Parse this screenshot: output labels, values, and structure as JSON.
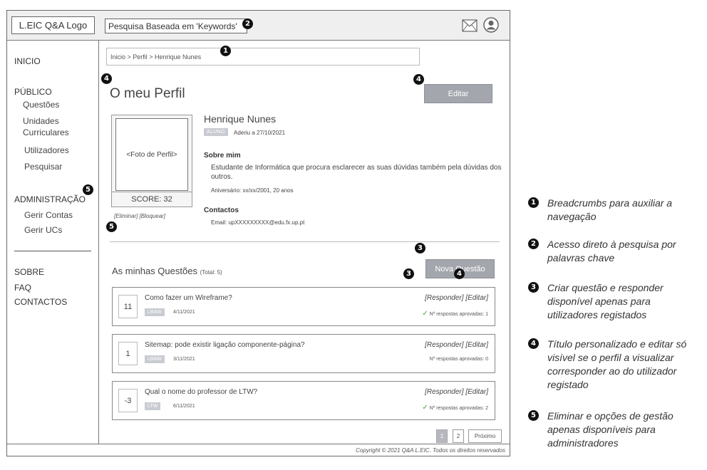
{
  "header": {
    "logo": "L.EIC Q&A Logo",
    "search_text": "Pesquisa Baseada em 'Keywords'",
    "mail_icon": "mail-icon",
    "user_icon": "user-icon"
  },
  "sidebar": {
    "inicio": "INICIO",
    "publico": "PÚBLICO",
    "questoes": "Questões",
    "unidades": "Unidades",
    "curriculares": "Curriculares",
    "utilizadores": "Utilizadores",
    "pesquisar": "Pesquisar",
    "administracao": "ADMINISTRAÇÃO",
    "gerir_contas": "Gerir Contas",
    "gerir_ucs": "Gerir UCs",
    "sobre": "SOBRE",
    "faq": "FAQ",
    "contactos": "CONTACTOS"
  },
  "breadcrumb": "Inicio > Perfil > Henrique Nunes",
  "profile": {
    "page_title": "O meu Perfil",
    "edit_button": "Editar",
    "photo_label": "<Foto de Perfil>",
    "score": "SCORE: 32",
    "admin_links": "[Eliminar] [Bloquear]",
    "name": "Henrique Nunes",
    "role_tag": "ALUNO",
    "joined": "Aderiu a 27/10/2021",
    "about_title": "Sobre mim",
    "bio": "Estudante de Informática que procura esclarecer as suas dúvidas também pela dúvidas dos outros.",
    "birthday": "Aniversário: xx/xx/2001, 20 anos",
    "contacts_title": "Contactos",
    "email": "Email: upXXXXXXXXX@edu.fx.up.pt"
  },
  "questions": {
    "heading": "As minhas Questões",
    "total": "(Total: 5)",
    "new_button": "Nova Questão",
    "items": [
      {
        "score": "11",
        "title": "Como fazer um Wireframe?",
        "tag": "LBAW",
        "date": "4/11/2021",
        "actions": "[Responder] [Editar]",
        "stat": "Nº respostas aprovadas: 1",
        "check": true
      },
      {
        "score": "1",
        "title": "Sitemap: pode existir ligação componente-página?",
        "tag": "LBAW",
        "date": "3/11/2021",
        "actions": "[Responder] [Editar]",
        "stat": "Nº respostas aprovadas: 0",
        "check": false
      },
      {
        "score": "-3",
        "title": "Qual o nome do professor de LTW?",
        "tag": "LTW",
        "date": "6/11/2021",
        "actions": "[Responder] [Editar]",
        "stat": "Nº respostas aprovadas: 2",
        "check": true
      }
    ],
    "check_glyph": "✓"
  },
  "pagination": {
    "page1": "1",
    "page2": "2",
    "next": "Próximo"
  },
  "footer": "Copyright © 2021 Q&A L.EIC. Todos os direitos reservados",
  "markers": {
    "m1": "1",
    "m2": "2",
    "m3": "3",
    "m4": "4",
    "m5": "5"
  },
  "legend": [
    {
      "num": "1",
      "text": "Breadcrumbs para auxiliar a navegação"
    },
    {
      "num": "2",
      "text": "Acesso direto à pesquisa por palavras chave"
    },
    {
      "num": "3",
      "text": "Criar questão e responder disponível apenas para utilizadores registados"
    },
    {
      "num": "4",
      "text": "Título personalizado e editar só visível se o perfil a visualizar corresponder ao do utilizador registado"
    },
    {
      "num": "5",
      "text": "Eliminar e opções de gestão apenas disponíveis para administradores"
    }
  ],
  "colors": {
    "button": "#a3a6ad",
    "tag": "#c9cbd2",
    "check": "#3aa63a"
  }
}
